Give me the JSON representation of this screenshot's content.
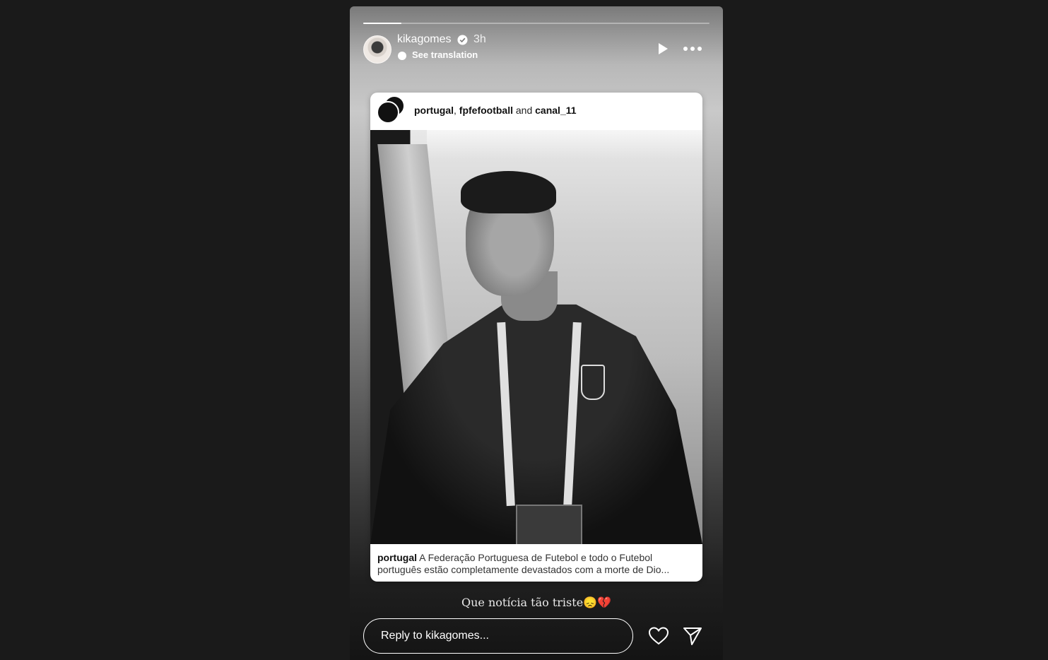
{
  "story": {
    "progress_fraction": 0.11,
    "author": {
      "username": "kikagomes",
      "time": "3h",
      "see_translation": "See translation"
    },
    "card": {
      "credits": {
        "user1": "portugal",
        "sep1": ", ",
        "user2": "fpfefootball",
        "sep2": " and ",
        "user3": "canal_11"
      },
      "caption": {
        "username": "portugal",
        "line1": "A Federação Portuguesa de Futebol e todo o Futebol",
        "line2": "português estão completamente devastados com a morte de Dio..."
      }
    },
    "text": "Que notícia tão triste😞💔",
    "reply_placeholder": "Reply to kikagomes...",
    "icons": {
      "play": "play-icon",
      "more": "more-icon",
      "like": "heart-icon",
      "send": "send-icon",
      "verified": "verified-badge-icon"
    }
  }
}
